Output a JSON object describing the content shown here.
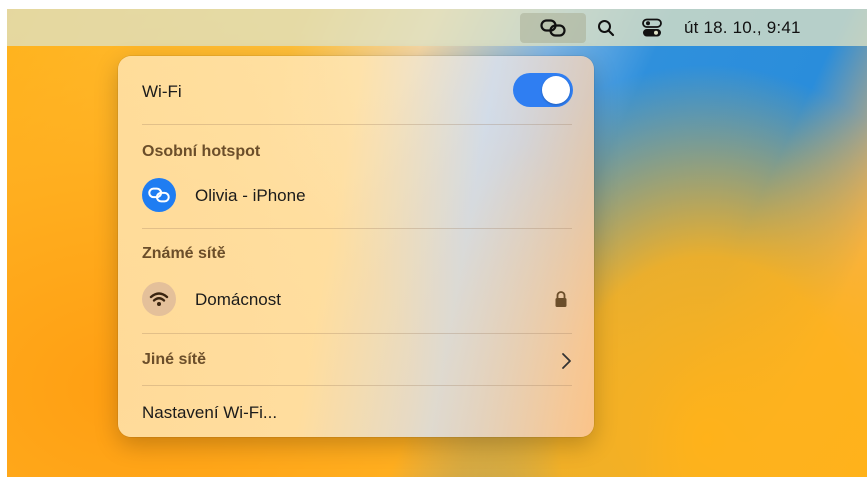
{
  "menubar": {
    "icons": [
      "personal-hotspot-icon",
      "search-icon",
      "control-center-icon"
    ],
    "clock": "út 18. 10.,  9:41"
  },
  "wifi_menu": {
    "title": "Wi-Fi",
    "toggle_on": true,
    "accent": "#2f7ef2",
    "personal_hotspot": {
      "label": "Osobní hotspot",
      "network": "Olivia - iPhone"
    },
    "known_networks": {
      "label": "Známé sítě",
      "network": "Domácnost",
      "secured": true
    },
    "other_networks": "Jiné sítě",
    "settings": "Nastavení Wi-Fi..."
  }
}
